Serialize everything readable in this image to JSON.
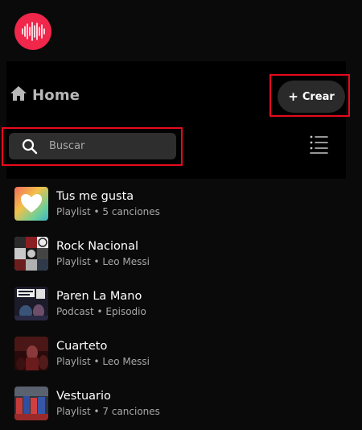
{
  "app": {
    "logo_icon": "soundwave-icon",
    "brand_color": "#f0264b"
  },
  "header": {
    "home_icon": "home-icon",
    "title": "Home",
    "create_label": "Crear",
    "create_icon": "plus-icon"
  },
  "search": {
    "placeholder": "Buscar",
    "icon": "search-icon",
    "list_icon": "list-view-icon"
  },
  "annotations": {
    "highlight_color": "#e8091e"
  },
  "library": [
    {
      "title": "Tus me gusta",
      "type": "Playlist",
      "detail": "5 canciones",
      "cover": "heart-cover"
    },
    {
      "title": "Rock Nacional",
      "type": "Playlist",
      "detail": "Leo Messi",
      "cover": "collage-cover"
    },
    {
      "title": "Paren La Mano",
      "type": "Podcast",
      "detail": "Episodio",
      "cover": "podcast-cover"
    },
    {
      "title": "Cuarteto",
      "type": "Playlist",
      "detail": "Leo Messi",
      "cover": "concert-cover"
    },
    {
      "title": "Vestuario",
      "type": "Playlist",
      "detail": "7 canciones",
      "cover": "team-cover"
    }
  ],
  "separator": "•"
}
